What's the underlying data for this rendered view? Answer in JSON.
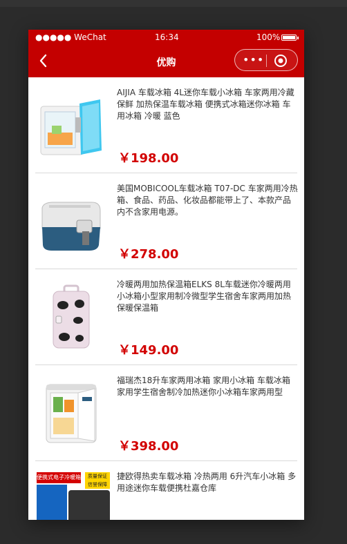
{
  "status_bar": {
    "carrier": "●●●●● WeChat",
    "time": "16:34",
    "battery_pct": "100%"
  },
  "nav": {
    "title": "优购",
    "more": "•••"
  },
  "colors": {
    "brand_red": "#c40000",
    "price_red": "#d20000"
  },
  "products": [
    {
      "title": "AIJIA 车载冰箱 4L迷你车载小冰箱 车家两用冷藏保鲜 加热保温车载冰箱 便携式冰箱迷你冰箱 车用冰箱 冷暖 蓝色",
      "price": "￥198.00",
      "image": "blue-mini-fridge-image"
    },
    {
      "title": "美国MOBICOOL车载冰箱 T07-DC 车家两用冷热箱、食品、药品、化妆品都能带上了、本款产品内不含家用电源。",
      "price": "￥278.00",
      "image": "cooler-box-image"
    },
    {
      "title": "冷暖两用加热保温箱ELKS 8L车载迷你冷暖两用小冰箱小型家用制冷微型学生宿舍车家两用加热保暖保温箱",
      "price": "￥149.00",
      "image": "cow-pattern-fridge-image"
    },
    {
      "title": "福瑞杰18升车家两用冰箱 家用小冰箱 车载冰箱家用学生宿舍制冷加热迷你小冰箱车家两用型",
      "price": "￥398.00",
      "image": "white-fridge-image"
    },
    {
      "title": "捷欧得热卖车载冰箱 冷热两用 6升汽车小冰箱 多用途迷你车载便携杜嘉仓库",
      "price": "",
      "image": "promo-cooler-image",
      "promo_line1": "便携式电子冷暖箱",
      "promo_line2": "质量保证",
      "promo_line3": "信誉保障"
    }
  ]
}
